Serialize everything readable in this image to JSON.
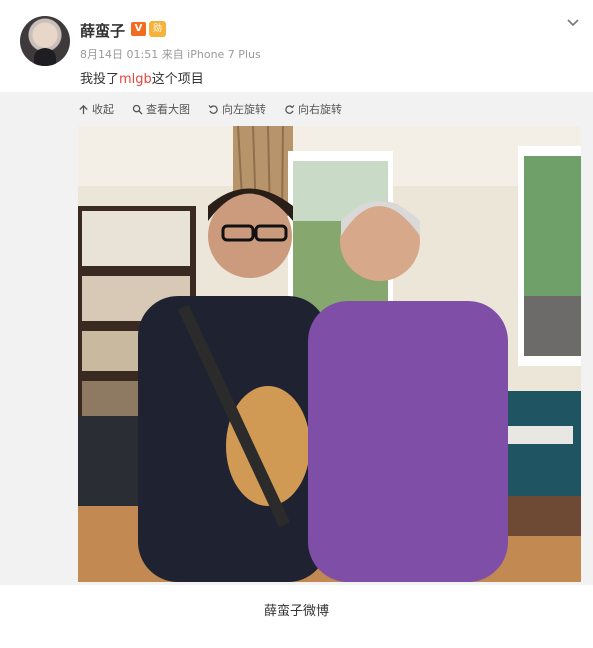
{
  "post": {
    "username": "薛蛮子",
    "vip_badge": "V",
    "level_badge": "勋",
    "meta": "8月14日 01:51 来自 iPhone 7 Plus",
    "text_before": "我投了",
    "tag": "mlgb",
    "text_after": "这个项目"
  },
  "toolbar": {
    "collapse": "收起",
    "view_large": "查看大图",
    "rotate_left": "向左旋转",
    "rotate_right": "向右旋转"
  },
  "caption": "薛蛮子微博",
  "colors": {
    "tag": "#e8453c",
    "vip": "#f26b22",
    "frame": "#f2f2f3"
  }
}
